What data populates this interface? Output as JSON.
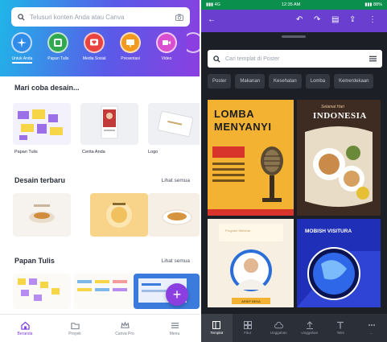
{
  "left": {
    "search": {
      "placeholder": "Telusuri konten Anda atau Canva"
    },
    "categories": [
      {
        "label": "Untuk Anda",
        "color": "#2f8ae8",
        "icon": "sparkle-icon"
      },
      {
        "label": "Papan Tulis",
        "color": "#2fa84f",
        "icon": "whiteboard-icon"
      },
      {
        "label": "Media Sosial",
        "color": "#e8433f",
        "icon": "heart-icon"
      },
      {
        "label": "Presentasi",
        "color": "#f39a1e",
        "icon": "presentation-icon"
      },
      {
        "label": "Video",
        "color": "#d94fd0",
        "icon": "video-icon"
      }
    ],
    "try_design": {
      "title": "Mari coba desain...",
      "items": [
        {
          "label": "Papan Tulis"
        },
        {
          "label": "Cerita Anda"
        },
        {
          "label": "Logo"
        }
      ]
    },
    "recent": {
      "title": "Desain terbaru",
      "see_all": "Lihat semua"
    },
    "whiteboards": {
      "title": "Papan Tulis",
      "see_all": "Lihat semua"
    },
    "fab_label": "+",
    "nav": [
      {
        "label": "Beranda",
        "icon": "home-icon",
        "active": true
      },
      {
        "label": "Proyek",
        "icon": "folder-icon",
        "active": false
      },
      {
        "label": "Canva Pro",
        "icon": "crown-icon",
        "active": false
      },
      {
        "label": "Menu",
        "icon": "menu-icon",
        "active": false
      }
    ]
  },
  "right": {
    "status": {
      "left": "▮▮▮ 4G",
      "time": "12:35 AM",
      "right": "▮▮▮ 88%"
    },
    "search": {
      "placeholder": "Cari templat di Poster"
    },
    "chips": [
      "Poster",
      "Makanan",
      "Kesehatan",
      "Lomba",
      "Kemerdekaan"
    ],
    "cards": {
      "c1": {
        "line1": "LOMBA",
        "line2": "MENYANYI"
      },
      "c2": {
        "script": "Selamat Hari",
        "title": "INDONESIA"
      },
      "c3": {
        "head": "Program Webinar",
        "caption": "ARIEF BEKA"
      },
      "c4": {
        "title": "MOBISH VISITURA"
      }
    },
    "nav": [
      {
        "label": "Templat",
        "icon": "template-icon",
        "active": true
      },
      {
        "label": "Fitur",
        "icon": "grid-icon",
        "active": false
      },
      {
        "label": "Unggahan",
        "icon": "cloud-icon",
        "active": false
      },
      {
        "label": "Unggahan",
        "icon": "upload-icon",
        "active": false
      },
      {
        "label": "Teks",
        "icon": "text-icon",
        "active": false
      },
      {
        "label": "...",
        "icon": "more-icon",
        "active": false
      }
    ]
  }
}
